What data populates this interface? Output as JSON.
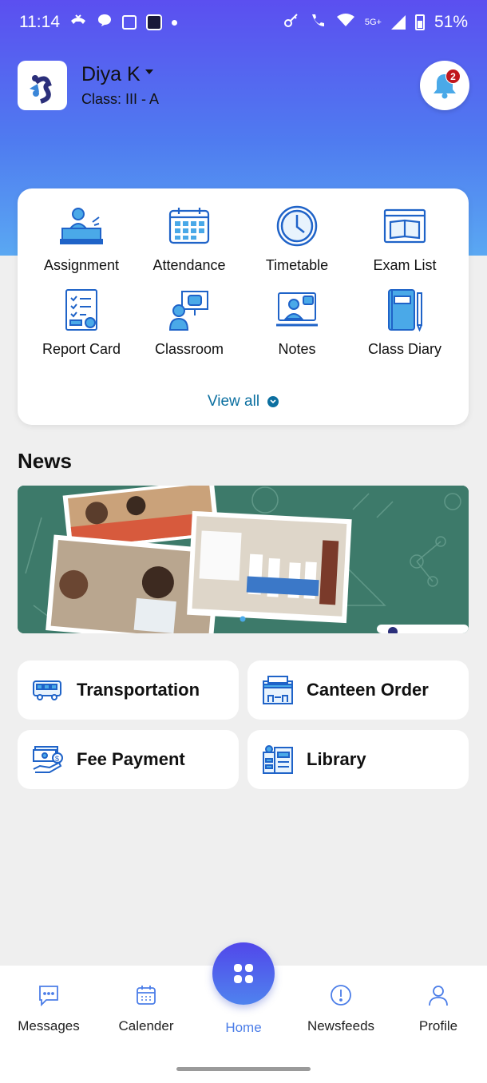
{
  "status_bar": {
    "time": "11:14",
    "network": "5G+",
    "battery": "51%"
  },
  "header": {
    "student_name": "Diya K",
    "student_class": "Class: III - A",
    "notification_count": "2"
  },
  "menu": {
    "items": [
      {
        "label": "Assignment",
        "icon": "assignment-icon"
      },
      {
        "label": "Attendance",
        "icon": "calendar-icon"
      },
      {
        "label": "Timetable",
        "icon": "clock-icon"
      },
      {
        "label": "Exam List",
        "icon": "book-icon"
      },
      {
        "label": "Report Card",
        "icon": "report-card-icon"
      },
      {
        "label": "Classroom",
        "icon": "classroom-icon"
      },
      {
        "label": "Notes",
        "icon": "notes-icon"
      },
      {
        "label": "Class Diary",
        "icon": "diary-icon"
      }
    ],
    "view_all": "View all"
  },
  "news": {
    "title": "News"
  },
  "quick_links": {
    "transportation": "Transportation",
    "canteen": "Canteen Order",
    "fee": "Fee Payment",
    "library": "Library"
  },
  "nav": {
    "messages": "Messages",
    "calendar": "Calender",
    "home": "Home",
    "newsfeeds": "Newsfeeds",
    "profile": "Profile"
  },
  "colors": {
    "accent": "#4c7ee8",
    "icon_blue": "#1f63c8",
    "badge_red": "#c0171d",
    "link": "#0b6fa0"
  }
}
